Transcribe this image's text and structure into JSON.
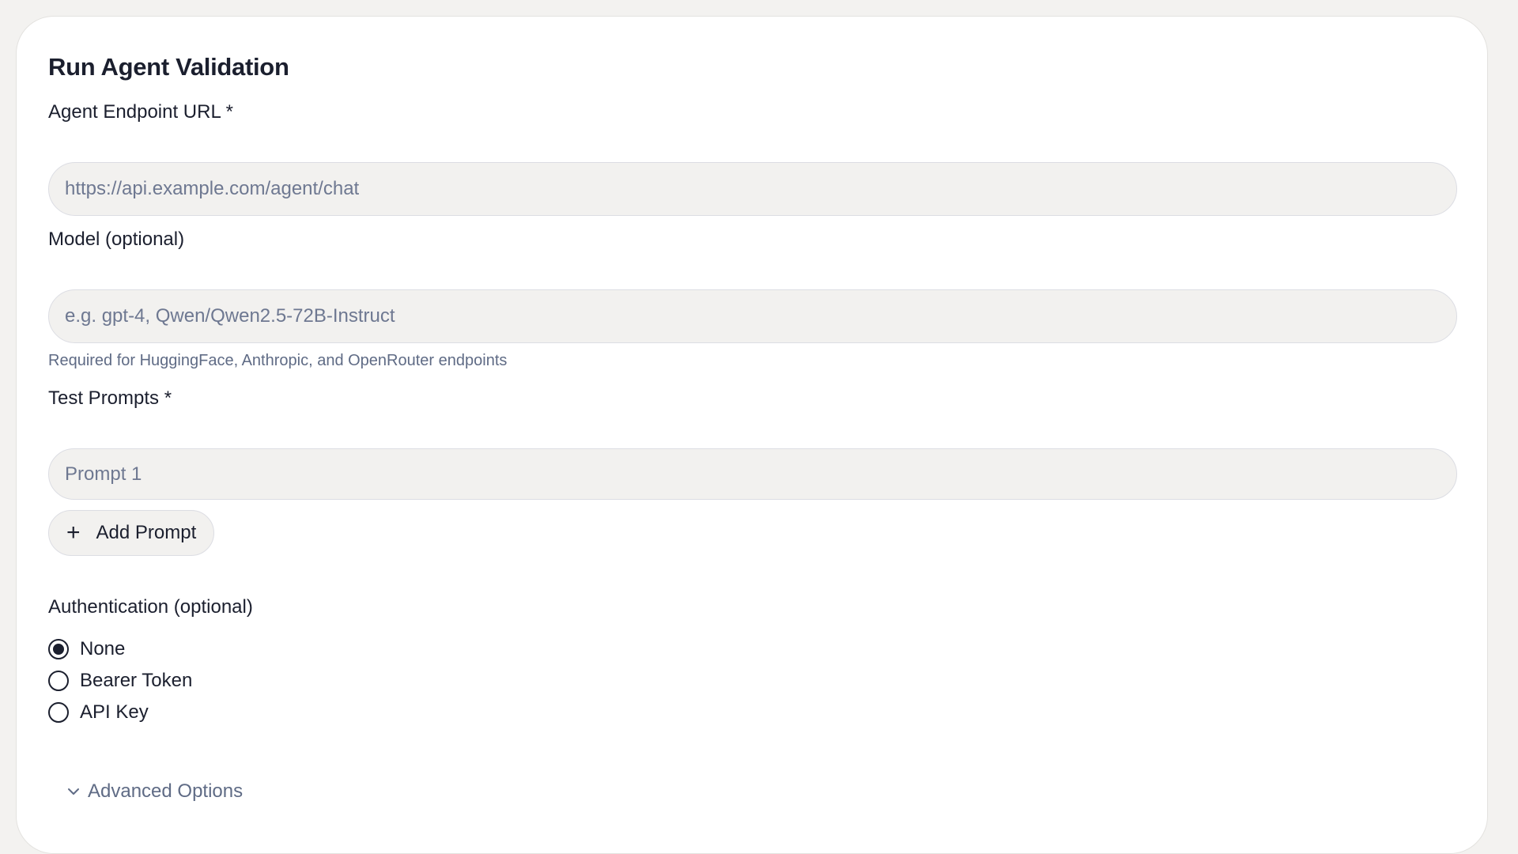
{
  "form": {
    "title": "Run Agent Validation",
    "endpoint": {
      "label": "Agent Endpoint URL *",
      "placeholder": "https://api.example.com/agent/chat",
      "value": ""
    },
    "model": {
      "label": "Model (optional)",
      "placeholder": "e.g. gpt-4, Qwen/Qwen2.5-72B-Instruct",
      "value": "",
      "hint": "Required for HuggingFace, Anthropic, and OpenRouter endpoints"
    },
    "prompts": {
      "label": "Test Prompts *",
      "items": [
        {
          "placeholder": "Prompt 1",
          "value": ""
        }
      ],
      "add_label": "Add Prompt"
    },
    "auth": {
      "label": "Authentication (optional)",
      "options": [
        "None",
        "Bearer Token",
        "API Key"
      ],
      "selected": "None"
    },
    "advanced_label": "Advanced Options"
  },
  "icons": {
    "add": "plus-icon",
    "advanced": "chevron-down-icon"
  }
}
